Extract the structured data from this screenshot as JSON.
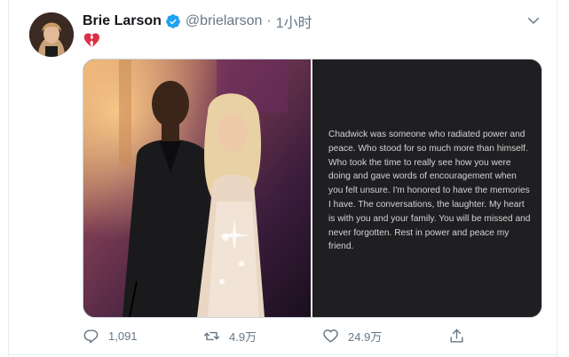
{
  "tweet": {
    "author_name": "Brie Larson",
    "author_handle": "@brielarson",
    "separator": "·",
    "timestamp": "1小时",
    "body_emoji": "broken-heart",
    "statement": "Chadwick was someone who radiated power and peace. Who stood for so much more than himself. Who took the time to really see how you were doing and gave words of encouragement when you felt unsure. I'm honored to have the memories I have. The conversations, the laughter. My heart is with you and your family. You will be missed and never forgotten. Rest in power and peace my friend."
  },
  "actions": {
    "replies": "1,091",
    "retweets": "4.9万",
    "likes": "24.9万"
  },
  "colors": {
    "accent": "#1da1f2",
    "muted": "#657786",
    "heart": "#e0245e"
  }
}
